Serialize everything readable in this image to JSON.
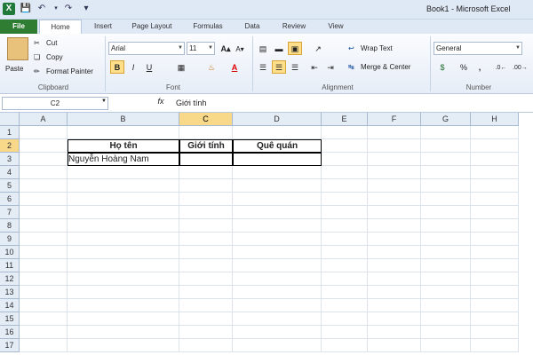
{
  "window": {
    "title": "Book1  -  Microsoft Excel"
  },
  "tabs": [
    "File",
    "Home",
    "Insert",
    "Page Layout",
    "Formulas",
    "Data",
    "Review",
    "View"
  ],
  "clipboard": {
    "paste": "Paste",
    "cut": "Cut",
    "copy": "Copy",
    "format_painter": "Format Painter",
    "group": "Clipboard"
  },
  "font": {
    "name": "Arial",
    "size": "11",
    "group": "Font",
    "bold": "B",
    "italic": "I",
    "underline": "U"
  },
  "alignment": {
    "wrap": "Wrap Text",
    "merge": "Merge & Center",
    "group": "Alignment"
  },
  "number": {
    "format": "General",
    "percent": "%",
    "comma": ",",
    "group": "Number"
  },
  "formula_bar": {
    "name_box": "C2",
    "fx": "fx",
    "content": "Giới tính"
  },
  "columns": [
    "A",
    "B",
    "C",
    "D",
    "E",
    "F",
    "G",
    "H"
  ],
  "rows": [
    "1",
    "2",
    "3",
    "4",
    "5",
    "6",
    "7",
    "8",
    "9",
    "10",
    "11",
    "12",
    "13",
    "14",
    "15",
    "16",
    "17"
  ],
  "cells": {
    "B2": "Họ tên",
    "C2": "Giới tính",
    "D2": "Quê quán",
    "B3": "Nguyễn Hoàng Nam"
  }
}
